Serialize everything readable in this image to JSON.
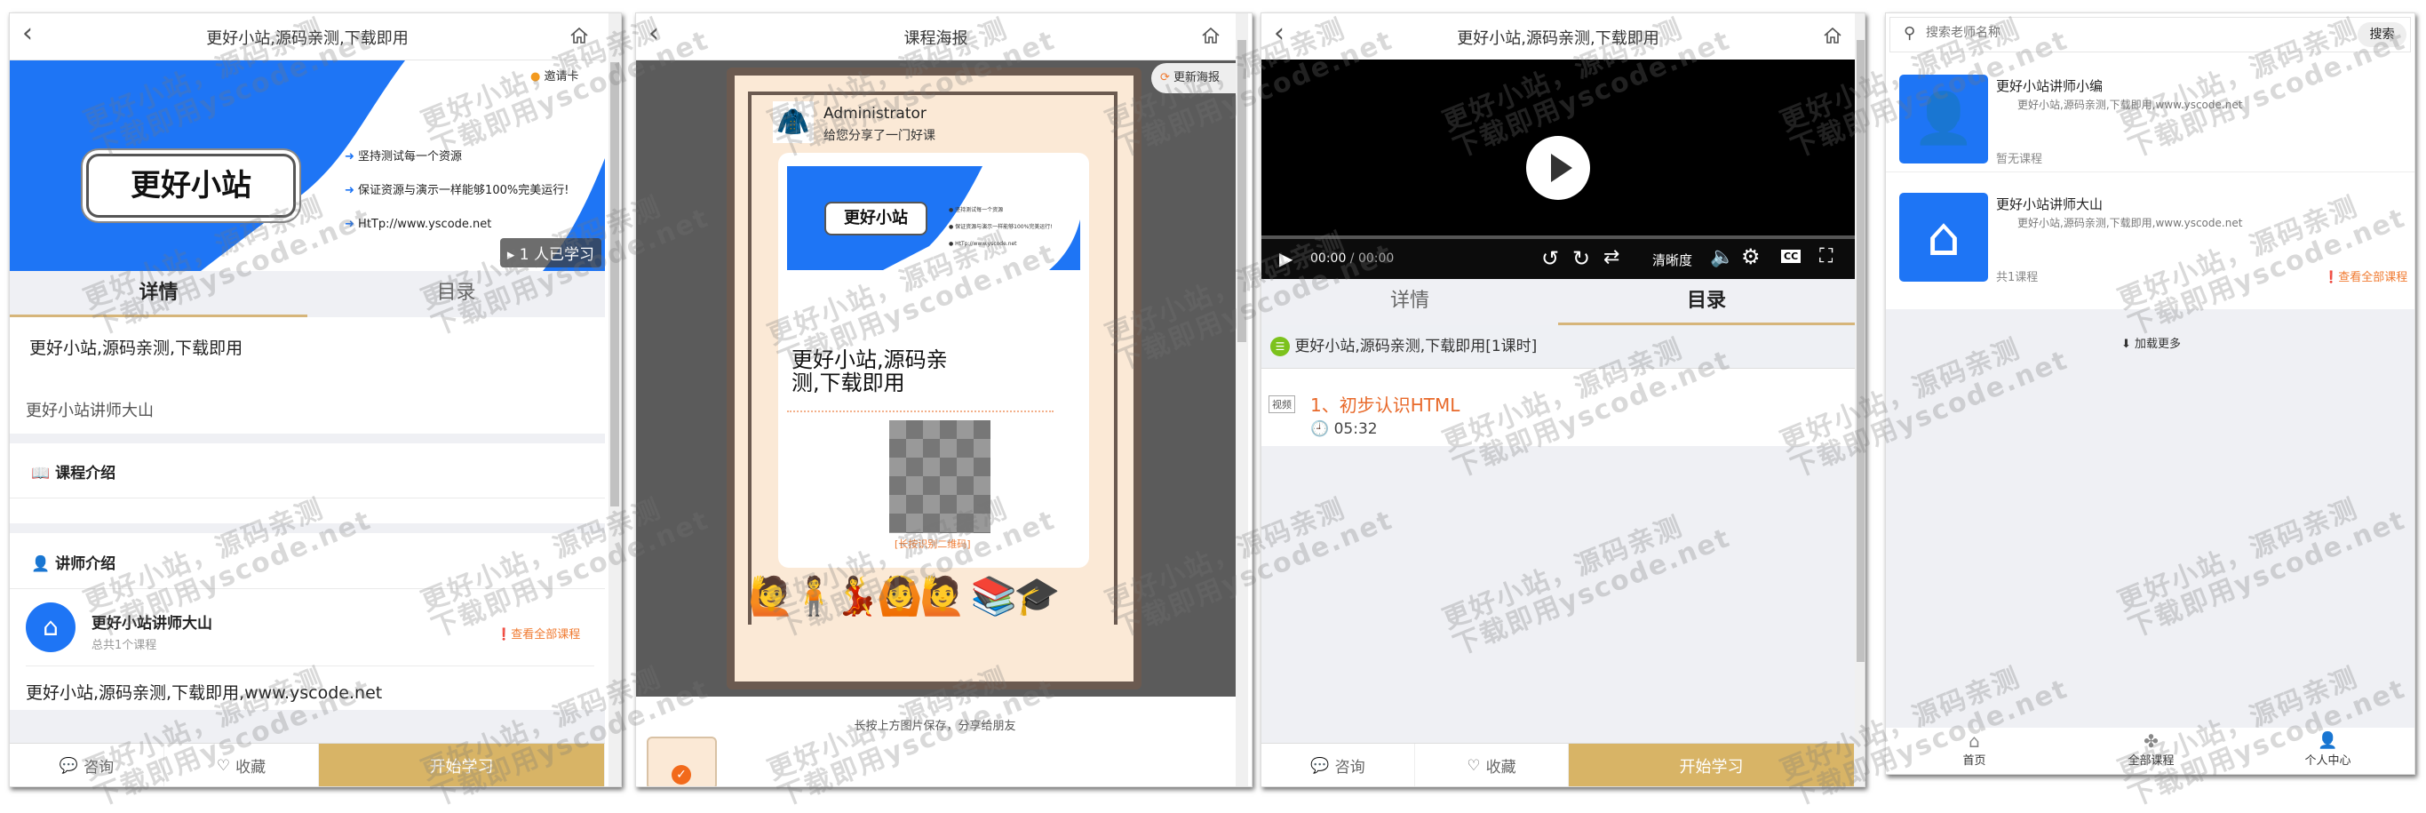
{
  "watermark": {
    "line1": "更好小站，源码亲测",
    "line2": "下载即用yscode.net"
  },
  "panel1": {
    "title": "更好小站,源码亲测,下载即用",
    "invite_label": "邀请卡",
    "banner": {
      "logo_text": "更好小站",
      "bullets": [
        "坚持测试每一个资源",
        "保证资源与演示一样能够100%完美运行!",
        "HtTp://www.yscode.net"
      ],
      "learners": "1 人已学习"
    },
    "tabs": [
      "详情",
      "目录"
    ],
    "course_title": "更好小站,源码亲测,下载即用",
    "teacher_line": "更好小站讲师大山",
    "course_intro_heading": "课程介绍",
    "teacher_intro_heading": "讲师介绍",
    "teacher": {
      "name": "更好小站讲师大山",
      "count": "总共1个课程",
      "view_all": "查看全部课程"
    },
    "teacher_desc": "更好小站,源码亲测,下载即用,www.yscode.net",
    "bottom": {
      "consult": "咨询",
      "favorite": "收藏",
      "start": "开始学习"
    }
  },
  "panel2": {
    "title": "课程海报",
    "refresh_label": "更新海报",
    "poster": {
      "user": "Administrator",
      "share_text": "给您分享了一门好课",
      "logo_text": "更好小站",
      "bullets": [
        "坚持测试每一个资源",
        "保证资源与演示一样能够100%完美运行!",
        "HtTp://www.yscode.net"
      ],
      "course_title": "更好小站,源码亲测,下载即用",
      "qr_hint": "[长按识别二维码]"
    },
    "save_hint": "长按上方图片保存，分享给朋友"
  },
  "panel3": {
    "title": "更好小站,源码亲测,下载即用",
    "player": {
      "time": "00:00",
      "duration": "00:00",
      "quality": "清晰度"
    },
    "tabs": [
      "详情",
      "目录"
    ],
    "chapter": "更好小站,源码亲测,下载即用[1课时]",
    "lesson": {
      "type": "视频",
      "title": "1、初步认识HTML",
      "length": "05:32"
    },
    "bottom": {
      "consult": "咨询",
      "favorite": "收藏",
      "start": "开始学习"
    }
  },
  "panel4": {
    "search_placeholder": "搜索老师名称",
    "search_button": "搜索",
    "teachers": [
      {
        "name": "更好小站讲师小编",
        "desc": "更好小站,源码亲测,下载即用,www.yscode.net",
        "courses": "暂无课程"
      },
      {
        "name": "更好小站讲师大山",
        "desc": "更好小站,源码亲测,下载即用,www.yscode.net",
        "courses": "共1课程",
        "view_all": "查看全部课程"
      }
    ],
    "load_more": "加载更多",
    "nav": [
      "首页",
      "全部课程",
      "个人中心"
    ]
  },
  "colors": {
    "brand_blue": "#1e75f5",
    "gold": "#d8b466",
    "orange": "#f07a30",
    "green": "#7cc21c"
  }
}
